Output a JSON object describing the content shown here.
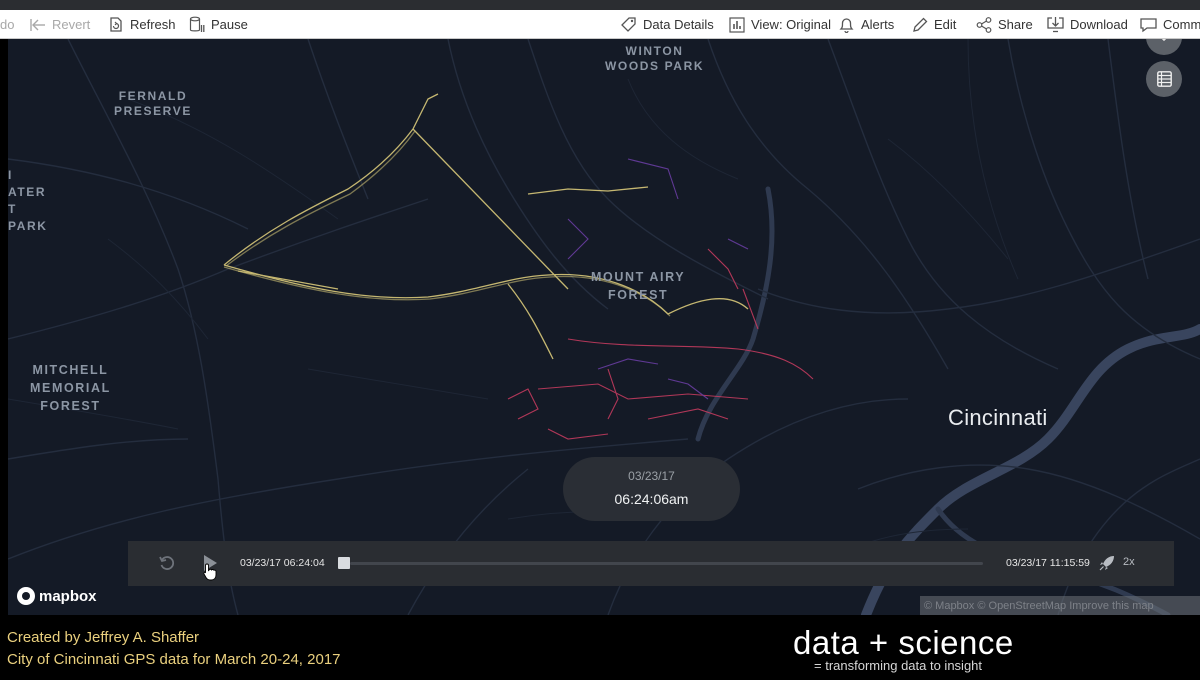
{
  "toolbar": {
    "undo_partial": "do",
    "revert": "Revert",
    "refresh": "Refresh",
    "pause": "Pause",
    "data_details": "Data Details",
    "view": "View: Original",
    "alerts": "Alerts",
    "edit": "Edit",
    "share": "Share",
    "download": "Download",
    "comments_partial": "Comm"
  },
  "map": {
    "labels": {
      "winton_1": "WINTON",
      "winton_2": "WOODS PARK",
      "fernald_1": "FERNALD",
      "fernald_2": "PRESERVE",
      "left_1": "I",
      "left_2": "ATER",
      "left_3": "T",
      "left_4": "PARK",
      "mount_airy_1": "MOUNT AIRY",
      "mount_airy_2": "FOREST",
      "mitchell_1": "MITCHELL",
      "mitchell_2": "MEMORIAL",
      "mitchell_3": "FOREST",
      "city": "Cincinnati"
    },
    "icons": [
      "chevron-down-icon",
      "table-icon"
    ]
  },
  "time_display": {
    "date": "03/23/17",
    "time": "06:24:06am"
  },
  "player": {
    "start": "03/23/17 06:24:04",
    "end": "03/23/17 11:15:59",
    "speed": "2x",
    "progress": 0.0
  },
  "mapbox": {
    "logo": "mapbox",
    "attribution": "© Mapbox © OpenStreetMap Improve this map"
  },
  "footer": {
    "credit_line1": "Created by Jeffrey A. Shaffer",
    "credit_line2": "City of Cincinnati GPS data for March 20-24, 2017",
    "brand": "data + science",
    "tagline": "= transforming data to insight"
  },
  "colors": {
    "map_bg": "#141a26",
    "road": "#2a3448",
    "river": "#3b4863",
    "track_yellow": "#d9c97a",
    "track_red": "#c23b5e",
    "track_purple": "#6d3fa8",
    "credit_text": "#ead07e"
  }
}
